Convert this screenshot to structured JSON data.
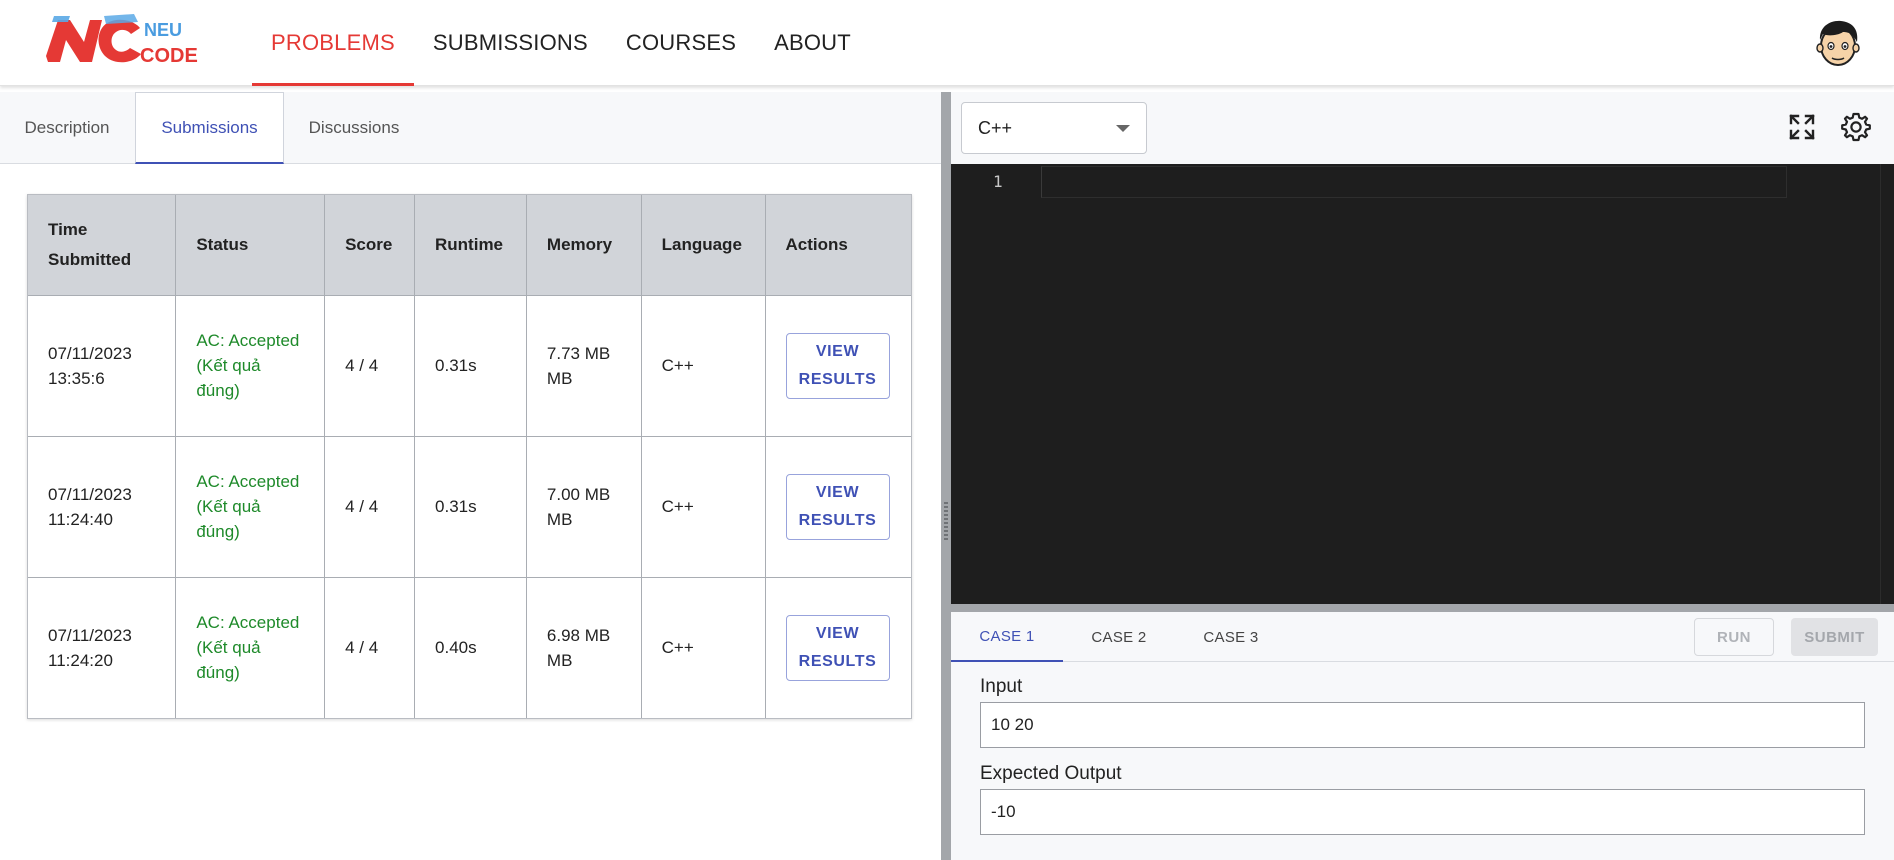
{
  "brand": {
    "logo_mark": "NC",
    "logo_text_top": "NEU",
    "logo_text_bottom": "CODE",
    "accent": "#e53935",
    "link_color": "#3f51b5"
  },
  "nav": {
    "items": [
      {
        "label": "PROBLEMS",
        "active": true
      },
      {
        "label": "SUBMISSIONS",
        "active": false
      },
      {
        "label": "COURSES",
        "active": false
      },
      {
        "label": "ABOUT",
        "active": false
      }
    ]
  },
  "left_tabs": [
    {
      "label": "Description",
      "active": false
    },
    {
      "label": "Submissions",
      "active": true
    },
    {
      "label": "Discussions",
      "active": false
    }
  ],
  "submissions": {
    "headers": [
      "Time Submitted",
      "Status",
      "Score",
      "Runtime",
      "Memory",
      "Language",
      "Actions"
    ],
    "rows": [
      {
        "date": "07/11/2023",
        "time": "13:35:6",
        "status": "AC: Accepted (Kết quả đúng)",
        "score": "4 / 4",
        "runtime": "0.31s",
        "memory": "7.73 MB MB",
        "language": "C++",
        "action": "VIEW RESULTS"
      },
      {
        "date": "07/11/2023",
        "time": "11:24:40",
        "status": "AC: Accepted (Kết quả đúng)",
        "score": "4 / 4",
        "runtime": "0.31s",
        "memory": "7.00 MB MB",
        "language": "C++",
        "action": "VIEW RESULTS"
      },
      {
        "date": "07/11/2023",
        "time": "11:24:20",
        "status": "AC: Accepted (Kết quả đúng)",
        "score": "4 / 4",
        "runtime": "0.40s",
        "memory": "6.98 MB MB",
        "language": "C++",
        "action": "VIEW RESULTS"
      }
    ]
  },
  "editor": {
    "language": "C++",
    "line_numbers": [
      "1"
    ],
    "icons": [
      "fullscreen-icon",
      "gear-icon"
    ]
  },
  "testcases": {
    "tabs": [
      {
        "label": "CASE 1",
        "active": true
      },
      {
        "label": "CASE 2",
        "active": false
      },
      {
        "label": "CASE 3",
        "active": false
      }
    ],
    "run_label": "RUN",
    "submit_label": "SUBMIT",
    "input_label": "Input",
    "input_value": "10 20",
    "output_label": "Expected Output",
    "output_value": "-10"
  }
}
